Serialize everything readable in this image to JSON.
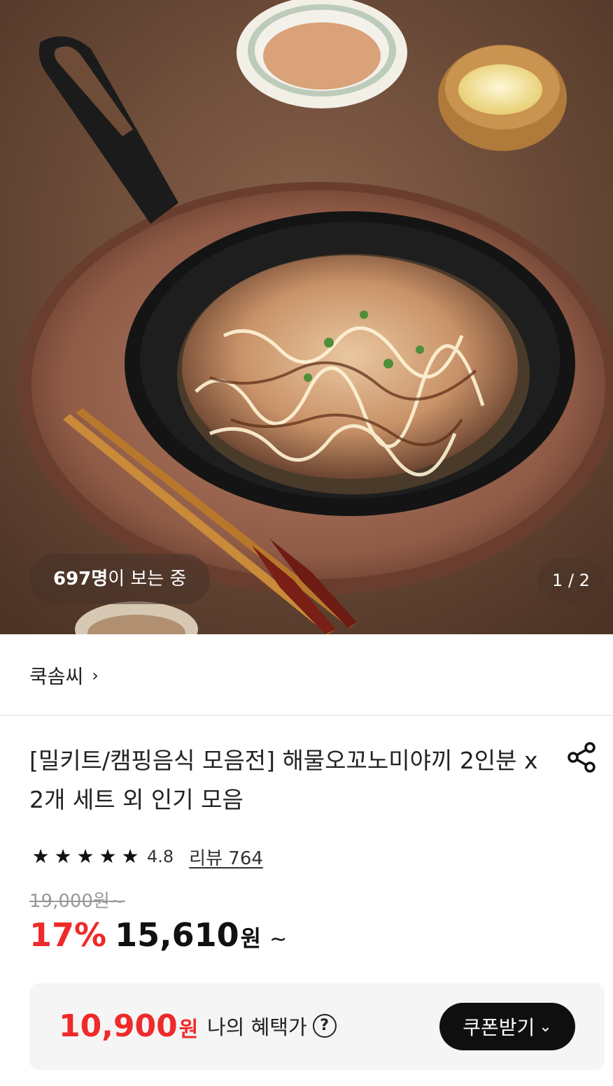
{
  "hero": {
    "viewers_count": "697명",
    "viewers_suffix": "이 보는 중",
    "pager": "1 / 2"
  },
  "brand": {
    "name": "쿡솜씨",
    "chevron": "›"
  },
  "product": {
    "title": "[밀키트/캠핑음식 모음전] 해물오꼬노미야끼 2인분 x 2개 세트 외 인기 모음",
    "rating": {
      "stars": [
        "★",
        "★",
        "★",
        "★",
        "★"
      ],
      "score": "4.8",
      "reviews": "리뷰 764"
    },
    "original_price": "19,000원~",
    "discount": "17%",
    "price": "15,610",
    "price_unit": "원",
    "price_suffix": "~"
  },
  "benefit": {
    "price": "10,900",
    "unit": "원",
    "label": "나의 혜택가",
    "help": "?",
    "coupon_button": "쿠폰받기",
    "coupon_chevron": "⌄"
  },
  "colors": {
    "accent": "#ef2a2a",
    "button": "#0f0f0f",
    "benefit_bg": "#f5f5f5"
  },
  "icons": [
    "share-icon",
    "help-icon",
    "chevron-right-icon",
    "chevron-down-icon",
    "star-icon"
  ]
}
